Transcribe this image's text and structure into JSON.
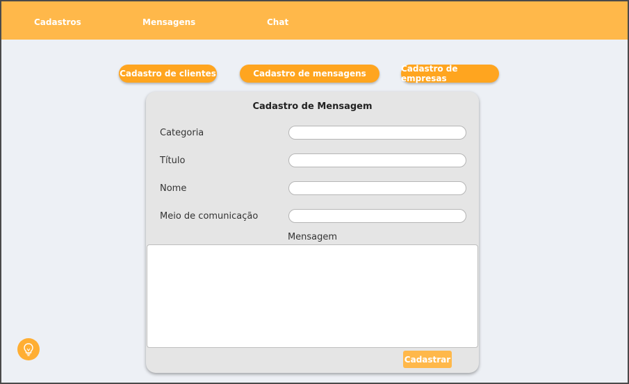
{
  "navbar": {
    "items": [
      {
        "label": "Cadastros"
      },
      {
        "label": "Mensagens"
      },
      {
        "label": "Chat"
      }
    ]
  },
  "pills": [
    {
      "label": "Cadastro de clientes"
    },
    {
      "label": "Cadastro de mensagens"
    },
    {
      "label": "Cadastro de empresas"
    }
  ],
  "form": {
    "title": "Cadastro de Mensagem",
    "fields": [
      {
        "label": "Categoria",
        "value": ""
      },
      {
        "label": "Título",
        "value": ""
      },
      {
        "label": "Nome",
        "value": ""
      },
      {
        "label": "Meio de comunicação",
        "value": ""
      }
    ],
    "message_label": "Mensagem",
    "message_value": "",
    "submit_label": "Cadastrar"
  },
  "help_icon": "lightbulb-icon",
  "colors": {
    "navbar": "#ffb84a",
    "pill": "#ffa51f",
    "background": "#edf0f5",
    "card": "#e5e5e5"
  }
}
